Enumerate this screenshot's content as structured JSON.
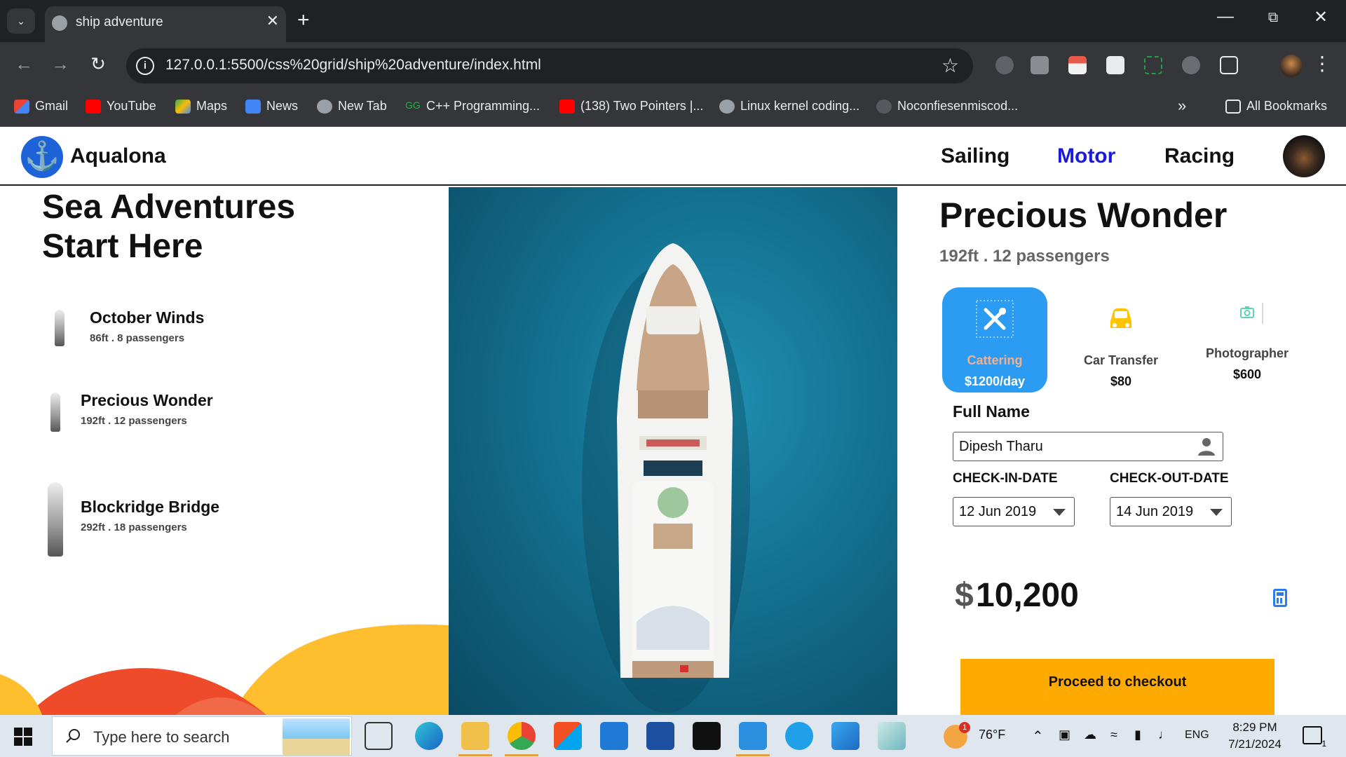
{
  "browser": {
    "tab_title": "ship adventure",
    "url": "127.0.0.1:5500/css%20grid/ship%20adventure/index.html",
    "bookmarks": [
      "Gmail",
      "YouTube",
      "Maps",
      "News",
      "New Tab",
      "C++ Programming...",
      "(138) Two Pointers |...",
      "Linux kernel coding...",
      "Noconfiesenmiscod..."
    ],
    "all_bookmarks": "All Bookmarks",
    "more_bookmarks": "»"
  },
  "site": {
    "brand": "Aqualona",
    "nav": [
      "Sailing",
      "Motor",
      "Racing"
    ],
    "active_nav": "Motor",
    "accent_color": "#1a1adc"
  },
  "hero": {
    "title_line1": "Sea Adventures",
    "title_line2": "Start Here"
  },
  "ships": [
    {
      "name": "October Winds",
      "meta": "86ft . 8 passengers"
    },
    {
      "name": "Precious Wonder",
      "meta": "192ft . 12 passengers"
    },
    {
      "name": "Blockridge Bridge",
      "meta": "292ft . 18 passengers"
    }
  ],
  "detail": {
    "title": "Precious Wonder",
    "meta": "192ft . 12 passengers",
    "services": [
      {
        "label": "Cattering",
        "price": "$1200/day",
        "selected": true,
        "icon": "cutlery-icon"
      },
      {
        "label": "Car Transfer",
        "price": "$80",
        "selected": false,
        "icon": "car-icon"
      },
      {
        "label": "Photographer",
        "price": "$600",
        "selected": false,
        "icon": "camera-icon"
      }
    ],
    "full_name_label": "Full Name",
    "full_name_value": "Dipesh Tharu",
    "checkin_label": "CHECK-IN-DATE",
    "checkin_value": "12 Jun 2019",
    "checkout_label": "CHECK-OUT-DATE",
    "checkout_value": "14 Jun 2019",
    "currency": "$",
    "total": "10,200",
    "checkout_button": "Proceed to checkout",
    "checkout_color": "#ffaa00"
  },
  "taskbar": {
    "search_placeholder": "Type here to search",
    "weather": "76°F",
    "weather_badge": "1",
    "language": "ENG",
    "time": "8:29 PM",
    "date": "7/21/2024",
    "notifications": "1"
  }
}
